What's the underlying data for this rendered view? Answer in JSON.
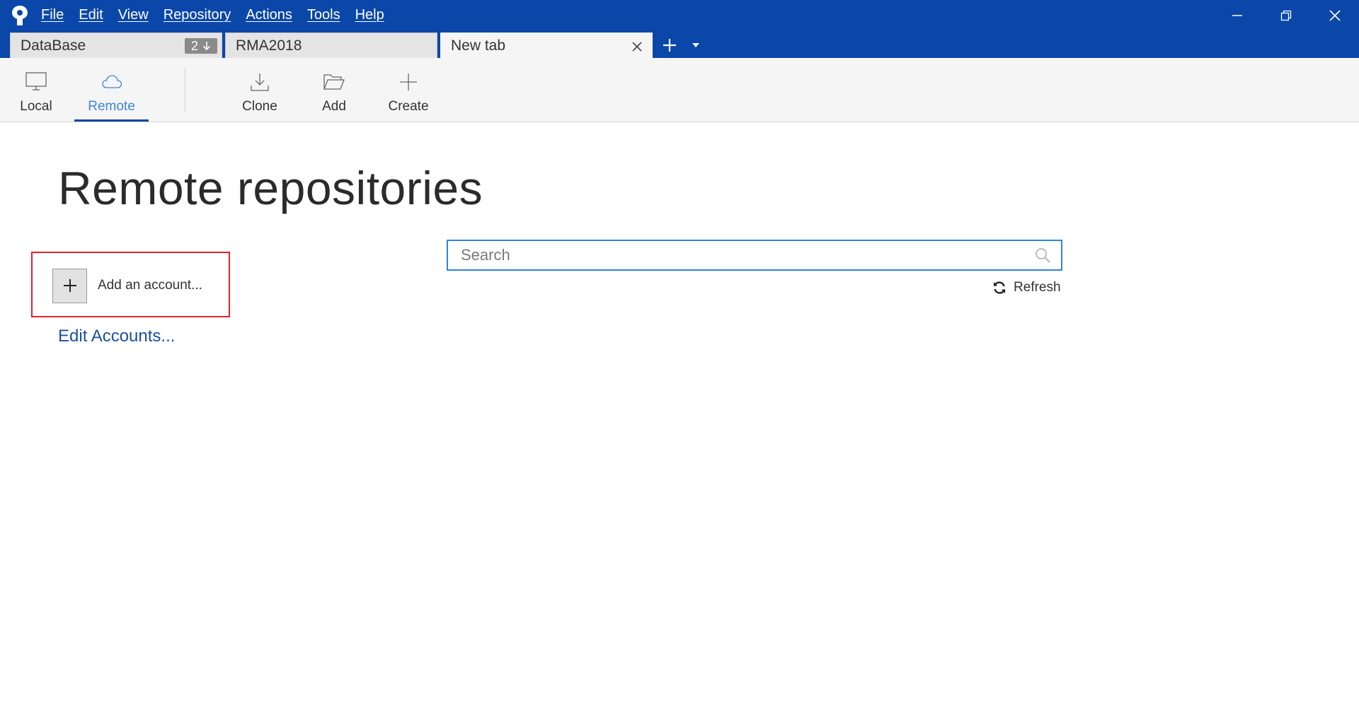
{
  "menu": {
    "items": [
      "File",
      "Edit",
      "View",
      "Repository",
      "Actions",
      "Tools",
      "Help"
    ]
  },
  "window_controls": {
    "minimize_icon": "minimize-icon",
    "restore_icon": "restore-icon",
    "close_icon": "close-icon"
  },
  "tabs": [
    {
      "label": "DataBase",
      "badge_count": "2",
      "badge_icon": "arrow-down-icon"
    },
    {
      "label": "RMA2018"
    },
    {
      "label": "New tab",
      "active": true
    }
  ],
  "toolbar": {
    "local_label": "Local",
    "remote_label": "Remote",
    "clone_label": "Clone",
    "add_label": "Add",
    "create_label": "Create"
  },
  "main": {
    "title": "Remote repositories",
    "add_account_label": "Add an account...",
    "edit_accounts_label": "Edit Accounts...",
    "search_placeholder": "Search",
    "refresh_label": "Refresh"
  },
  "colors": {
    "titlebar": "#0a47a9",
    "accent": "#3a86d6",
    "link": "#1c4fa0",
    "highlight": "#e0232e"
  }
}
